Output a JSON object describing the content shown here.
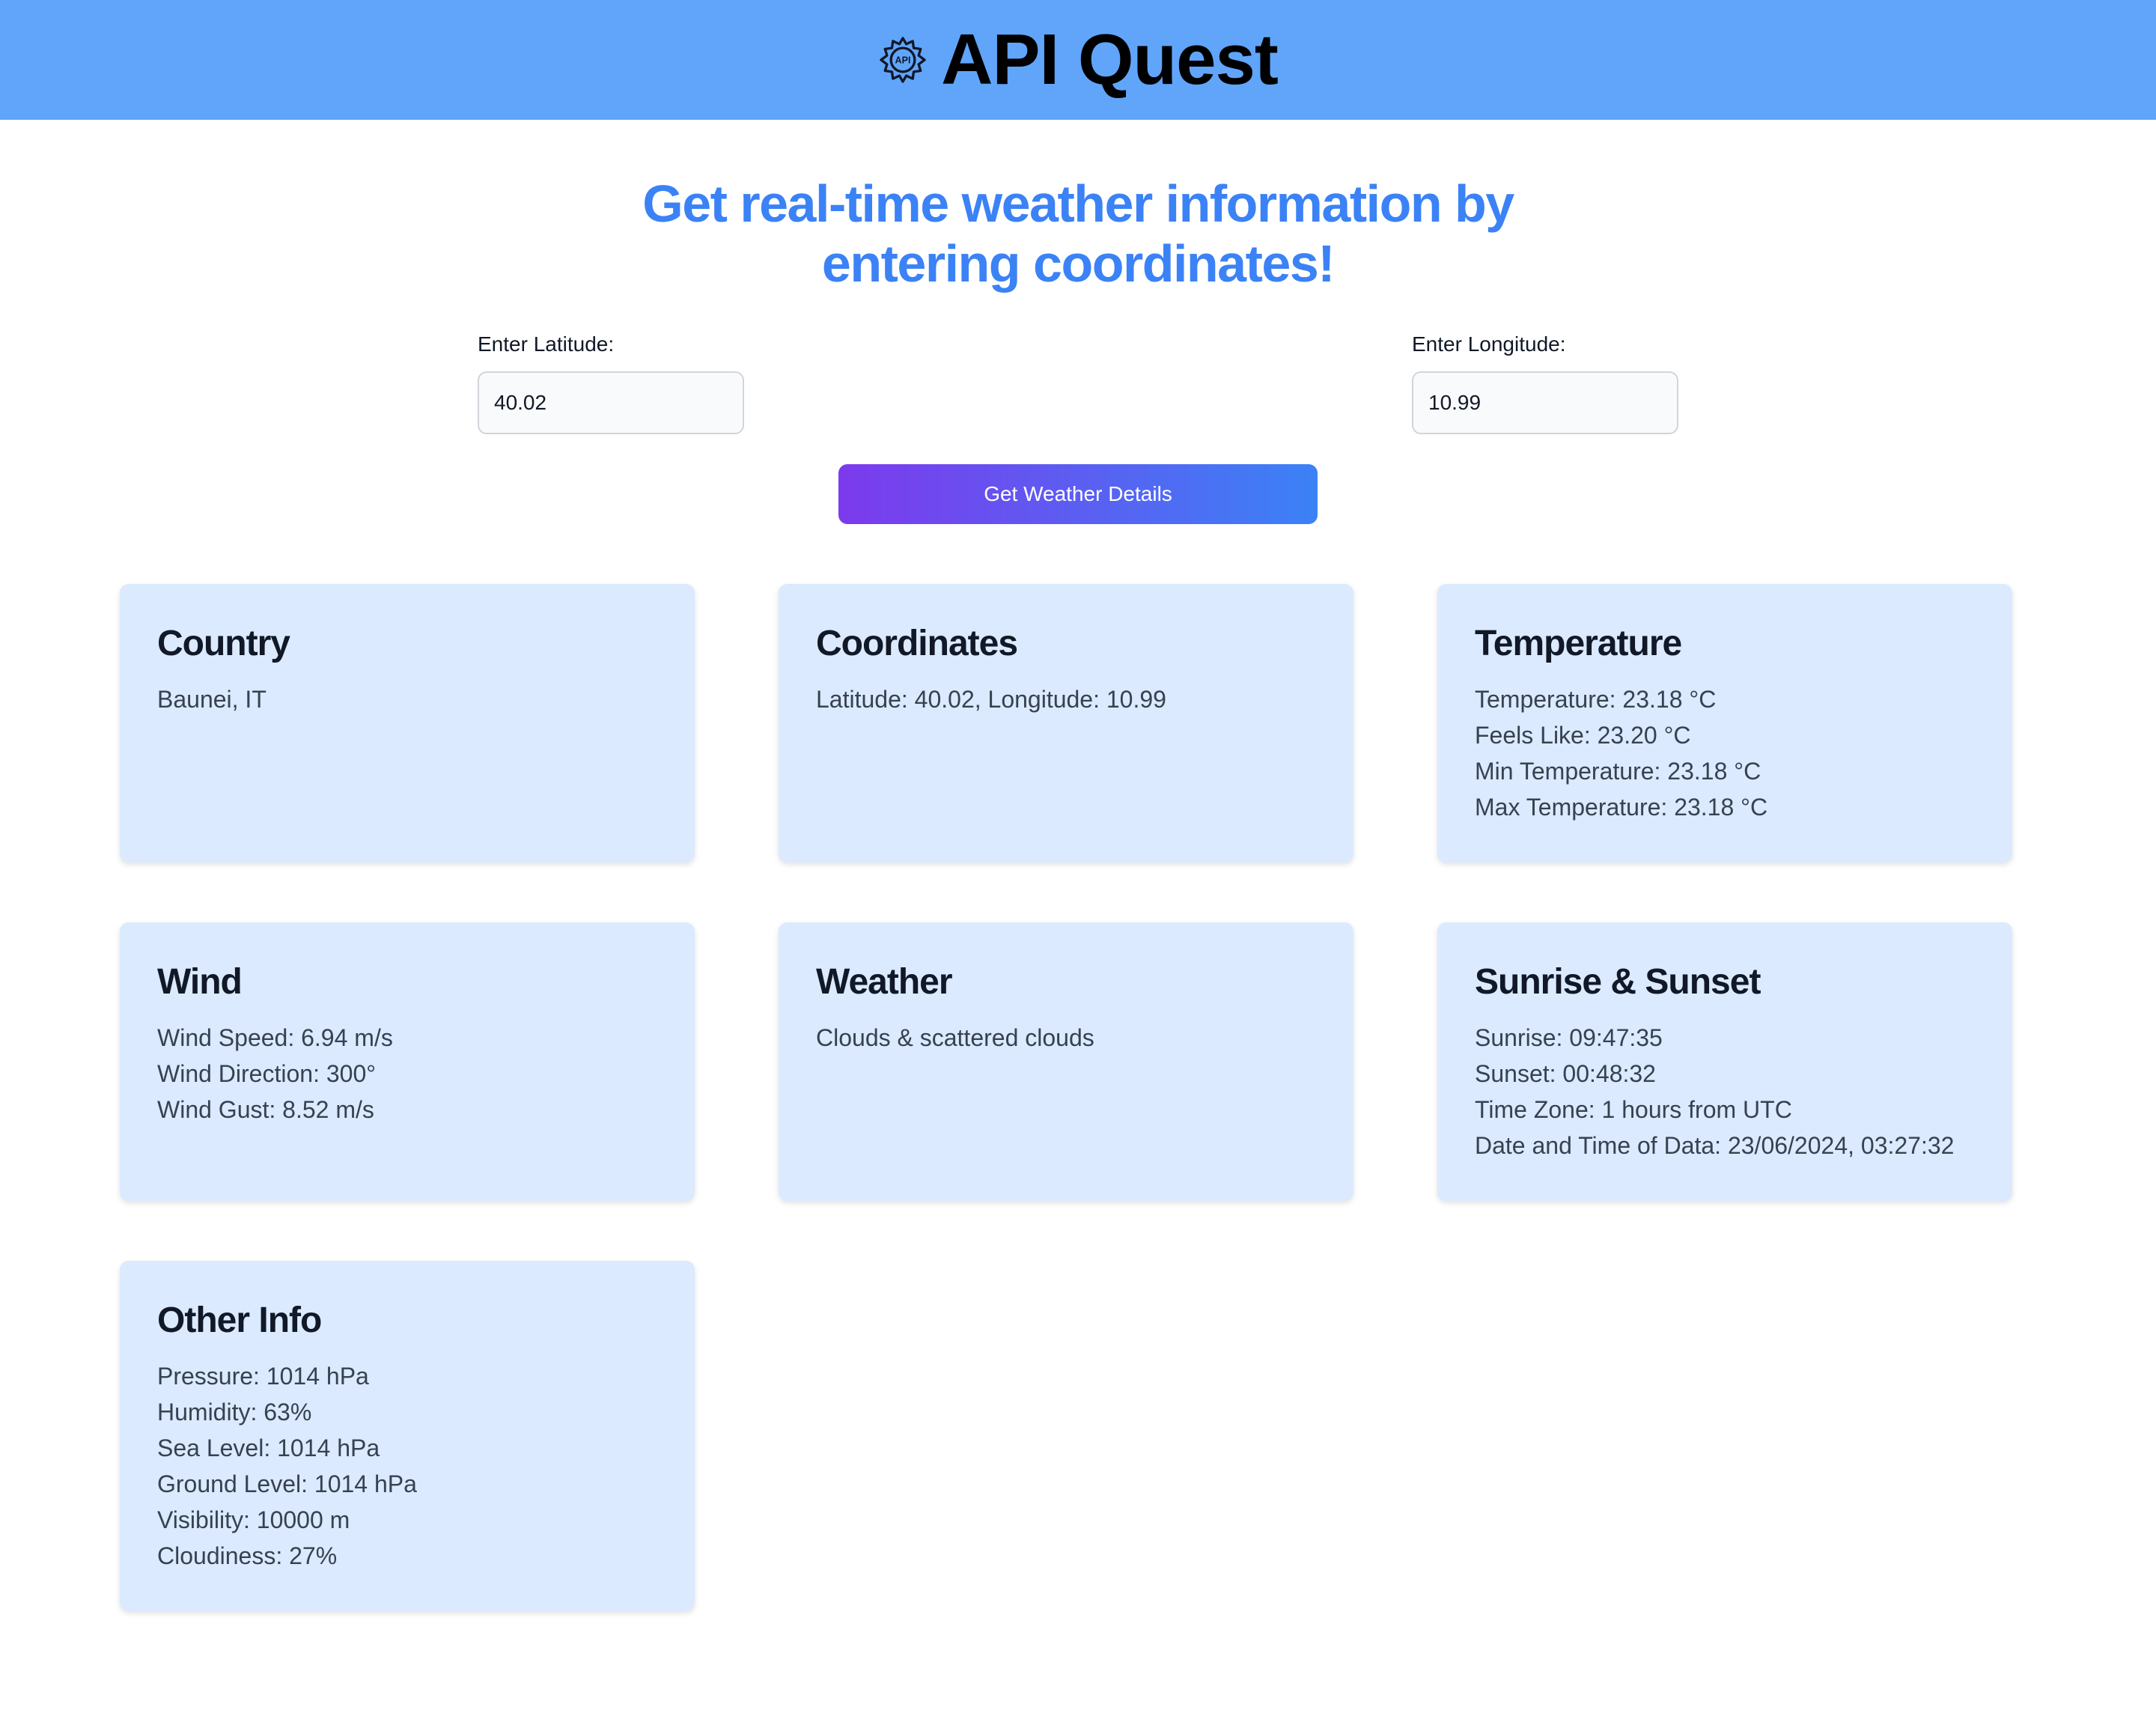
{
  "header": {
    "icon": "api-gear-icon",
    "icon_text": "API",
    "title": "API Quest",
    "background": "#60a5fa"
  },
  "headline": {
    "line1": "Get real-time weather information by",
    "line2": "entering coordinates!",
    "color": "#3b82f6"
  },
  "form": {
    "latitude": {
      "label": "Enter Latitude:",
      "value": "40.02"
    },
    "longitude": {
      "label": "Enter Longitude:",
      "value": "10.99"
    },
    "submit_label": "Get Weather Details"
  },
  "cards": {
    "country": {
      "title": "Country",
      "lines": [
        "Baunei, IT"
      ]
    },
    "coordinates": {
      "title": "Coordinates",
      "lines": [
        "Latitude: 40.02, Longitude: 10.99"
      ]
    },
    "temperature": {
      "title": "Temperature",
      "lines": [
        "Temperature: 23.18 °C",
        "Feels Like: 23.20 °C",
        "Min Temperature: 23.18 °C",
        "Max Temperature: 23.18 °C"
      ]
    },
    "wind": {
      "title": "Wind",
      "lines": [
        "Wind Speed: 6.94 m/s",
        "Wind Direction: 300°",
        "Wind Gust: 8.52 m/s"
      ]
    },
    "weather": {
      "title": "Weather",
      "lines": [
        "Clouds & scattered clouds"
      ]
    },
    "sun": {
      "title": "Sunrise & Sunset",
      "lines": [
        "Sunrise: 09:47:35",
        "Sunset: 00:48:32",
        "Time Zone: 1 hours from UTC",
        "Date and Time of Data: 23/06/2024, 03:27:32"
      ]
    },
    "other": {
      "title": "Other Info",
      "lines": [
        "Pressure: 1014 hPa",
        "Humidity: 63%",
        "Sea Level: 1014 hPa",
        "Ground Level: 1014 hPa",
        "Visibility: 10000 m",
        "Cloudiness: 27%"
      ]
    }
  }
}
